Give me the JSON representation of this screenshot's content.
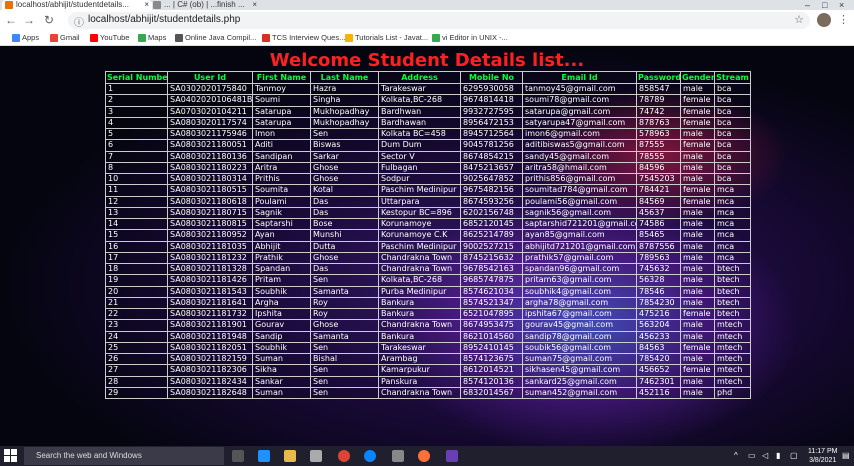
{
  "browser": {
    "tabs": [
      {
        "title": "localhost/abhijit/studentdetails..."
      },
      {
        "title": "... | C# (ob) | ...finish ..."
      }
    ],
    "url": "localhost/abhijit/studentdetails.php",
    "bookmarks": [
      {
        "label": "Apps",
        "icon": "apps-grid-icon",
        "color": "#4285f4"
      },
      {
        "label": "Gmail",
        "icon": "gmail-icon",
        "color": "#ea4335"
      },
      {
        "label": "YouTube",
        "icon": "youtube-icon",
        "color": "#ff0000"
      },
      {
        "label": "Maps",
        "icon": "maps-icon",
        "color": "#34a853"
      },
      {
        "label": "Online Java Compil...",
        "icon": "java-icon",
        "color": "#555555"
      },
      {
        "label": "TCS Interview Ques...",
        "icon": "tcs-icon",
        "color": "#d93025"
      },
      {
        "label": "Tutorials List - Javat...",
        "icon": "javatpoint-icon",
        "color": "#f4b400"
      },
      {
        "label": "vi Editor in UNIX -...",
        "icon": "vi-icon",
        "color": "#34a853"
      }
    ]
  },
  "page": {
    "title": "Welcome Student Details list...",
    "columns": [
      "Serial Number",
      "User Id",
      "First Name",
      "Last Name",
      "Address",
      "Mobile No",
      "Email Id",
      "Password",
      "Gender",
      "Stream"
    ],
    "rows": [
      [
        "1",
        "SA0302020175840",
        "Tanmoy",
        "Hazra",
        "Tarakeswar",
        "6295930058",
        "tanmoy45@gmail.com",
        "858547",
        "male",
        "bca"
      ],
      [
        "2",
        "SA0402020106481B",
        "Soumi",
        "Singha",
        "Kolkata,BC-268",
        "9674814418",
        "soumi78@gmail.com",
        "78789",
        "female",
        "bca"
      ],
      [
        "3",
        "SA0703020104211",
        "Satarupa",
        "Mukhopadhay",
        "Bardhwan",
        "9932727595",
        "satarupa@gmail.com",
        "74742",
        "female",
        "bca"
      ],
      [
        "4",
        "SA0803020117574",
        "Satarupa",
        "Mukhopadhay",
        "Bardhawan",
        "8956472153",
        "satyarupa47@gmail.com",
        "878763",
        "female",
        "bca"
      ],
      [
        "5",
        "SA0803021175946",
        "Imon",
        "Sen",
        "Kolkata BC=458",
        "8945712564",
        "imon6@gmail.com",
        "578963",
        "male",
        "bca"
      ],
      [
        "6",
        "SA0803021180051",
        "Aditi",
        "Biswas",
        "Dum Dum",
        "9045781256",
        "aditibiswas5@gmail.com",
        "87555",
        "female",
        "bca"
      ],
      [
        "7",
        "SA0803021180136",
        "Sandipan",
        "Sarkar",
        "Sector V",
        "8674854215",
        "sandy45@gmail.com",
        "78555",
        "male",
        "bca"
      ],
      [
        "8",
        "SA0803021180223",
        "Aritra",
        "Ghose",
        "Fulbagan",
        "8475213657",
        "aritra58@hmail.com",
        "84596",
        "male",
        "bca"
      ],
      [
        "10",
        "SA0803021180314",
        "Prithis",
        "Ghose",
        "Sodpur",
        "9025647852",
        "prithis856@gmail.com",
        "7545203",
        "male",
        "bca"
      ],
      [
        "11",
        "SA0803021180515",
        "Soumita",
        "Kotal",
        "Paschim Medinipur",
        "9675482156",
        "soumitad784@gmail.com",
        "784421",
        "female",
        "mca"
      ],
      [
        "12",
        "SA0803021180618",
        "Poulami",
        "Das",
        "Uttarpara",
        "8674593256",
        "poulami56@gmail.com",
        "84569",
        "female",
        "mca"
      ],
      [
        "13",
        "SA0803021180715",
        "Sagnik",
        "Das",
        "Kestopur BC=896",
        "6202156748",
        "sagnik56@gmail.com",
        "45637",
        "male",
        "mca"
      ],
      [
        "14",
        "SA0803021180815",
        "Saptarshi",
        "Bose",
        "Korunamoye",
        "6852120145",
        "saptarshid721201@gmail.com",
        "74586",
        "male",
        "mca"
      ],
      [
        "15",
        "SA0803021180952",
        "Ayan",
        "Munshi",
        "Korunamoye C.K",
        "8625214789",
        "ayan85@gmail.com",
        "85465",
        "male",
        "mca"
      ],
      [
        "16",
        "SA0803021181035",
        "Abhijit",
        "Dutta",
        "Paschim Medinipur",
        "9002527215",
        "abhijitd721201@gmail.com",
        "8787556",
        "male",
        "mca"
      ],
      [
        "17",
        "SA0803021181232",
        "Prathik",
        "Ghose",
        "Chandrakna Town",
        "8745215632",
        "prathik57@gmail.com",
        "789563",
        "male",
        "mca"
      ],
      [
        "18",
        "SA0803021181328",
        "Spandan",
        "Das",
        "Chandrakna Town",
        "9678542163",
        "spandan96@gmail.com",
        "745632",
        "male",
        "btech"
      ],
      [
        "19",
        "SA0803021181426",
        "Pritam",
        "Sen",
        "Kolkata,BC-268",
        "9685747875",
        "pritam63@gmail.com",
        "56328",
        "male",
        "btech"
      ],
      [
        "20",
        "SA0803021181543",
        "Soubhik",
        "Samanta",
        "Purba Medinipur",
        "8574621034",
        "soubhik4@gmail.com",
        "78546",
        "male",
        "btech"
      ],
      [
        "21",
        "SA0803021181641",
        "Argha",
        "Roy",
        "Bankura",
        "8574521347",
        "argha78@gmail.com",
        "7854230",
        "male",
        "btech"
      ],
      [
        "22",
        "SA0803021181732",
        "Ipshita",
        "Roy",
        "Bankura",
        "6521047895",
        "ipshita67@gmail.com",
        "475216",
        "female",
        "btech"
      ],
      [
        "23",
        "SA0803021181901",
        "Gourav",
        "Ghose",
        "Chandrakna Town",
        "8674953475",
        "gourav45@gmail.com",
        "563204",
        "male",
        "mtech"
      ],
      [
        "24",
        "SA0803021181948",
        "Sandip",
        "Samanta",
        "Bankura",
        "8621014560",
        "sandip78@gmail.com",
        "456233",
        "male",
        "mtech"
      ],
      [
        "25",
        "SA0803021182051",
        "Soubhik",
        "Sen",
        "Tarakeswar",
        "8952410145",
        "soubik56@gmail.com",
        "84563",
        "female",
        "mtech"
      ],
      [
        "26",
        "SA0803021182159",
        "Suman",
        "Bishal",
        "Arambag",
        "8574123675",
        "suman75@gmail.com",
        "785420",
        "male",
        "mtech"
      ],
      [
        "27",
        "SA0803021182306",
        "Sikha",
        "Sen",
        "Kamarpukur",
        "8612014521",
        "sikhasen45@gmail.com",
        "456652",
        "female",
        "mtech"
      ],
      [
        "28",
        "SA0803021182434",
        "Sankar",
        "Sen",
        "Panskura",
        "8574120136",
        "sankard25@gmail.com",
        "7462301",
        "male",
        "mtech"
      ],
      [
        "29",
        "SA0803021182648",
        "Suman",
        "Sen",
        "Chandrakna Town",
        "6832014567",
        "suman452@gmail.com",
        "452116",
        "male",
        "phd"
      ]
    ]
  },
  "taskbar": {
    "search_placeholder": "Search the web and Windows",
    "time": "11:17 PM",
    "date": "3/8/2021"
  }
}
